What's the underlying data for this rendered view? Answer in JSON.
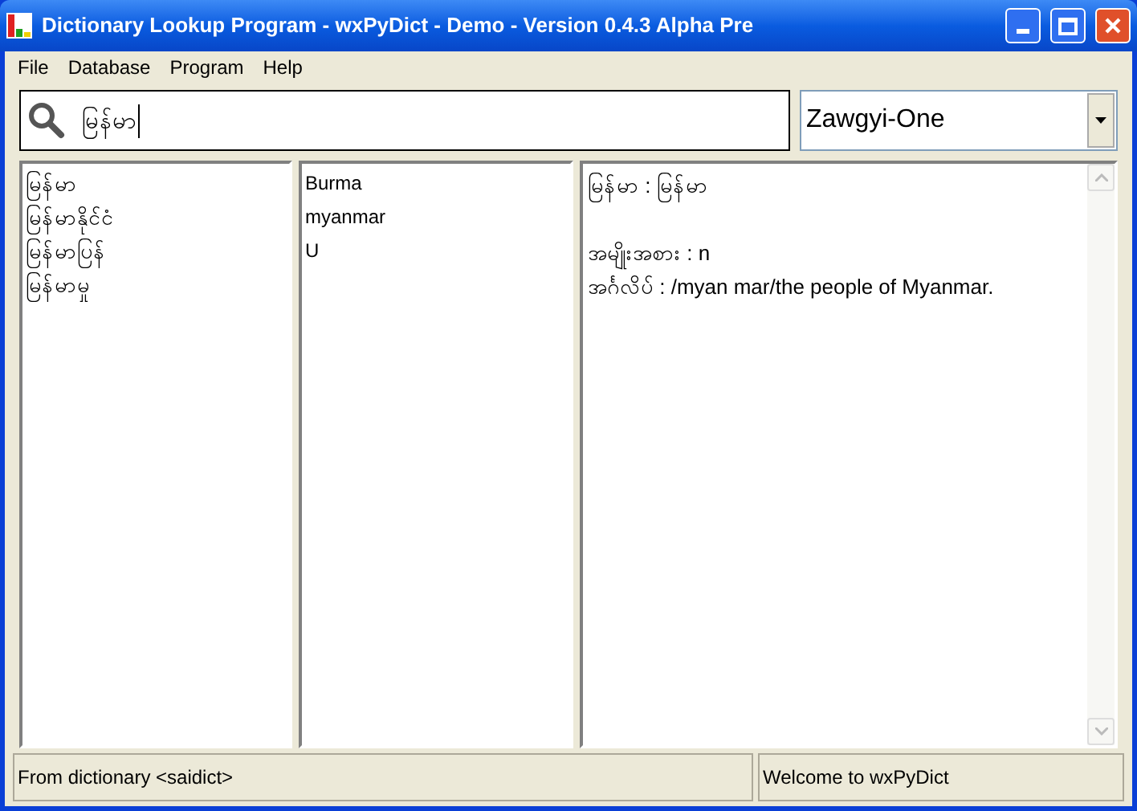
{
  "window": {
    "title": "Dictionary Lookup Program - wxPyDict - Demo - Version 0.4.3 Alpha Pre"
  },
  "menu": [
    "File",
    "Database",
    "Program",
    "Help"
  ],
  "search": {
    "value": "မြန်မာ"
  },
  "font_select": {
    "value": "Zawgyi-One"
  },
  "words": [
    "မြန်မာ",
    "မြန်မာနိုင်ငံ",
    "မြန်မာပြန်",
    "မြန်မာမှု"
  ],
  "translations": [
    "Burma",
    "myanmar",
    "U"
  ],
  "definition": {
    "heading": "မြန်မာ : မြန်မာ",
    "lines": [
      "အမျိုးအစား : n",
      "အင်္ဂလိပ် : /myan mar/the people of Myanmar."
    ]
  },
  "status_bar": [
    "From dictionary <saidict>",
    "Welcome to wxPyDict"
  ]
}
